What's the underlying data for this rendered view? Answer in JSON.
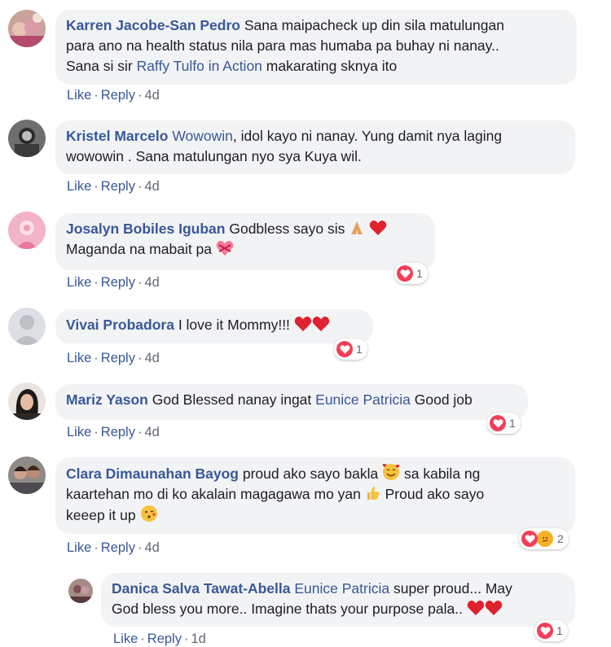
{
  "actions": {
    "like": "Like",
    "reply": "Reply",
    "separator": "·"
  },
  "comments": [
    {
      "author": "Karren Jacobe-San Pedro",
      "line1": "Sana maipacheck up din sila matulungan",
      "line2": "para ano na health status nila para mas humaba pa buhay ni nanay..",
      "line3_pre": "Sana si sir ",
      "tag": "Raffy Tulfo in Action",
      "line3_post": " makarating sknya ito",
      "time": "4d"
    },
    {
      "author": "Kristel Marcelo",
      "tag": "Wowowin",
      "line1_post": ", idol kayo ni nanay. Yung damit nya laging",
      "line2": "wowowin . Sana matulungan nyo sya Kuya wil.",
      "time": "4d"
    },
    {
      "author": "Josalyn Bobiles Iguban",
      "line1": "Godbless sayo sis",
      "line2": "Maganda na mabait pa",
      "time": "4d",
      "reaction_count": "1"
    },
    {
      "author": "Vivai Probadora",
      "line1": "I love it Mommy!!!",
      "time": "4d",
      "reaction_count": "1"
    },
    {
      "author": "Mariz Yason",
      "line1_pre": "God Blessed nanay ingat ",
      "tag": "Eunice Patricia",
      "line1_post": " Good job",
      "time": "4d",
      "reaction_count": "1"
    },
    {
      "author": "Clara Dimaunahan Bayog",
      "line1": "proud ako sayo bakla",
      "line1_post": " sa kabila ng",
      "line2": "kaartehan mo di ko akalain magagawa mo yan",
      "line2_post": " Proud ako sayo",
      "line3": "keeep it up",
      "time": "4d",
      "reaction_count": "2"
    },
    {
      "author": "Danica Salva Tawat-Abella",
      "tag": "Eunice Patricia",
      "line1_post": " super proud... May",
      "line2": "God bless you more.. Imagine thats your purpose pala..",
      "time": "1d",
      "reaction_count": "1"
    }
  ]
}
